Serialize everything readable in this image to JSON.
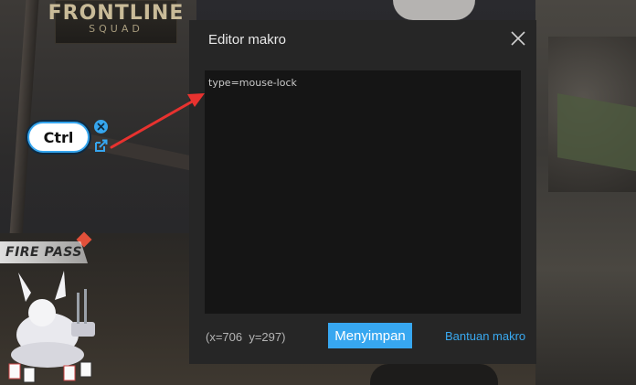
{
  "background": {
    "logo_line1": "FRONTLINE",
    "logo_line2": "SQUAD",
    "fire_pass": "FIRE PASS"
  },
  "key_overlay": {
    "key_label": "Ctrl",
    "accent_color": "#36a6ef",
    "icons": [
      "close-icon",
      "edit-icon"
    ]
  },
  "dialog": {
    "title": "Editor makro",
    "editor_text": "type=mouse-lock",
    "coordinates": "(x=706  y=297)",
    "save_label": "Menyimpan",
    "help_label": "Bantuan makro",
    "accent_color": "#37a7f0",
    "icons": [
      "close-icon"
    ]
  },
  "annotation": {
    "arrow_color": "#e8322f"
  }
}
